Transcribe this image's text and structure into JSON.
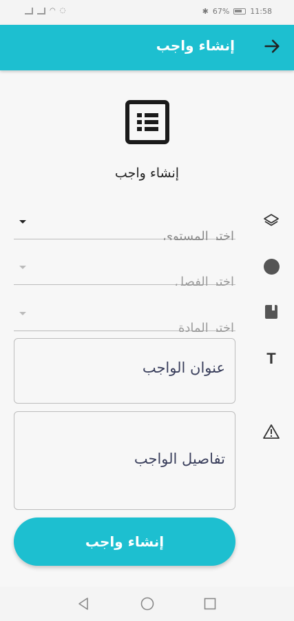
{
  "status_bar": {
    "time": "11:58",
    "battery": "67%"
  },
  "app_bar": {
    "title": "إنشاء واجب"
  },
  "header": {
    "title": "إنشاء واجب",
    "icon": "list-icon"
  },
  "form": {
    "level_placeholder": "اختر المستوى",
    "class_placeholder": "اختر الفصل",
    "subject_placeholder": "اختر المادة",
    "title_placeholder": "عنوان الواجب",
    "details_placeholder": "تفاصيل الواجب"
  },
  "submit": {
    "label": "إنشاء واجب"
  },
  "colors": {
    "accent": "#1dbfd0",
    "background": "#f7f7f7"
  }
}
